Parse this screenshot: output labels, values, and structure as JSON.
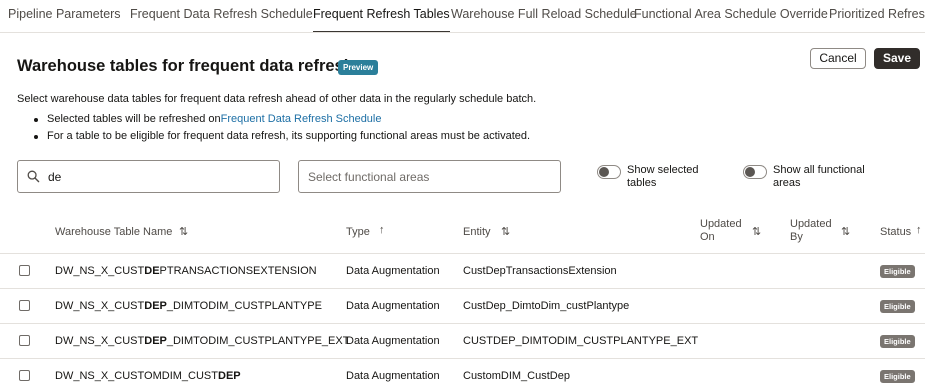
{
  "tabs": [
    {
      "label": "Pipeline Parameters"
    },
    {
      "label": "Frequent Data Refresh Schedule"
    },
    {
      "label": "Frequent Refresh Tables"
    },
    {
      "label": "Warehouse Full Reload Schedule"
    },
    {
      "label": "Functional Area Schedule Override"
    },
    {
      "label": "Prioritized Refresh"
    }
  ],
  "header": {
    "title": "Warehouse tables for frequent data refresh",
    "badge": "Preview",
    "cancel_label": "Cancel",
    "save_label": "Save"
  },
  "description": {
    "intro": "Select warehouse data tables for frequent data refresh ahead of other data in the regularly schedule batch.",
    "bullet1_prefix": "Selected tables will be refreshed on ",
    "bullet1_link": "Frequent Data Refresh Schedule",
    "bullet2": "For a table to be eligible for frequent data refresh, its supporting functional areas must be activated."
  },
  "filters": {
    "search_value": "de",
    "functional_areas_placeholder": "Select functional areas",
    "show_selected_line1": "Show selected",
    "show_selected_line2": "tables",
    "show_all_line1": "Show all functional",
    "show_all_line2": "areas"
  },
  "table": {
    "columns": {
      "name": "Warehouse Table Name",
      "type": "Type",
      "entity": "Entity",
      "updated_on_line1": "Updated",
      "updated_on_line2": "On",
      "updated_by_line1": "Updated",
      "updated_by_line2": "By",
      "status": "Status"
    },
    "rows": [
      {
        "name_pre": "DW_NS_X_CUST",
        "name_match": "DE",
        "name_post": "PTRANSACTIONSEXTENSION",
        "type": "Data Augmentation",
        "entity": "CustDepTransactionsExtension",
        "status": "Eligible"
      },
      {
        "name_pre": "DW_NS_X_CUST",
        "name_match": "DEP",
        "name_post": "_DIMTODIM_CUSTPLANTYPE",
        "type": "Data Augmentation",
        "entity": "CustDep_DimtoDim_custPlantype",
        "status": "Eligible"
      },
      {
        "name_pre": "DW_NS_X_CUST",
        "name_match": "DEP",
        "name_post": "_DIMTODIM_CUSTPLANTYPE_EXT",
        "type": "Data Augmentation",
        "entity": "CUSTDEP_DIMTODIM_CUSTPLANTYPE_EXT",
        "status": "Eligible"
      },
      {
        "name_pre": "DW_NS_X_CUSTOMDIM_CUST",
        "name_match": "DEP",
        "name_post": "",
        "type": "Data Augmentation",
        "entity": "CustomDIM_CustDep",
        "status": "Eligible"
      }
    ]
  },
  "colors": {
    "accent_badge": "#2b7f9a",
    "status_badge": "#7a7570",
    "link": "#1d6fa5",
    "save_button": "#312d2a"
  }
}
